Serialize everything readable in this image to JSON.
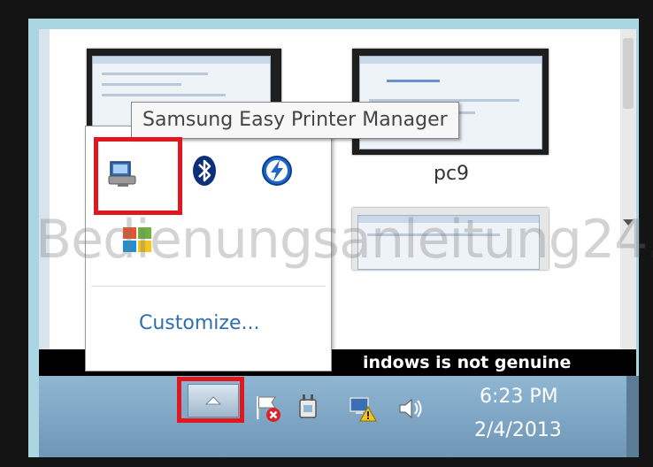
{
  "tooltip": {
    "text": "Samsung Easy Printer Manager"
  },
  "thumbnail": {
    "label": "pc9"
  },
  "tray_panel": {
    "icons": [
      "printer-manager-icon",
      "bluetooth-icon",
      "intel-rapid-storage-icon",
      "windows-update-icon"
    ],
    "customize_label": "Customize..."
  },
  "genuine_notice": "indows is not genuine",
  "taskbar": {
    "show_hidden_icons": "chevron-up-icon",
    "tray_icons": [
      "action-center-flag-error-icon",
      "network-warning-icon",
      "power-plug-icon",
      "volume-icon"
    ],
    "clock_time": "6:23 PM",
    "clock_date": "2/4/2013"
  },
  "watermark": "Bedienungsanleitung24.de",
  "colors": {
    "highlight": "#e0171f",
    "frame": "#a9d6e2",
    "taskbar": "#7fa6c4",
    "link": "#2d6fb0"
  }
}
